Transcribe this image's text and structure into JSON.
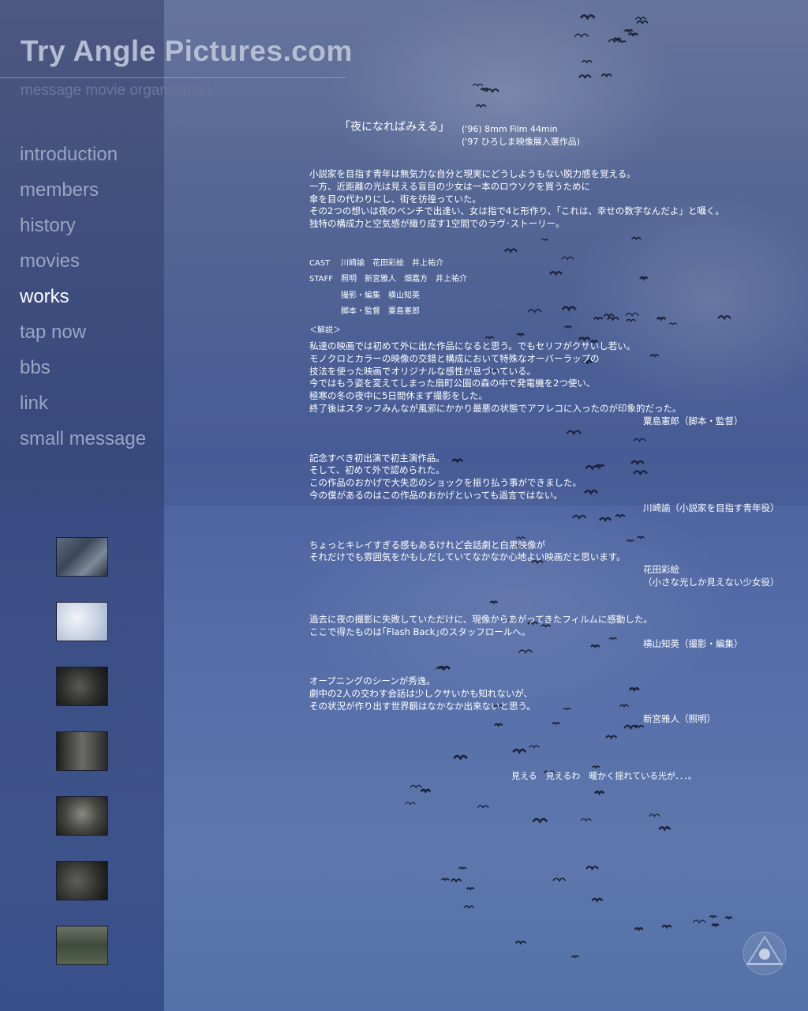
{
  "site": {
    "logo": "Try Angle Pictures.com",
    "tagline": "message movie organization"
  },
  "nav": {
    "items": [
      {
        "label": "introduction"
      },
      {
        "label": "members"
      },
      {
        "label": "history"
      },
      {
        "label": "movies"
      },
      {
        "label": "works",
        "active": true
      },
      {
        "label": "tap now"
      },
      {
        "label": "bbs"
      },
      {
        "label": "link"
      },
      {
        "label": "small message"
      }
    ]
  },
  "film": {
    "title": "「夜になればみえる」",
    "meta_line1": "('96) 8mm Film  44min",
    "meta_line2": "('97 ひろしま映像展入選作品)",
    "synopsis": [
      "小説家を目指す青年は無気力な自分と現実にどうしようもない脱力感を覚える。",
      "一方、近距離の光は見える盲目の少女は一本のロウソクを買うために",
      "傘を目の代わりにし、街を彷徨っていた。",
      "その2つの想いは夜のベンチで出逢い、女は指で4と形作り、「これは、幸せの数字なんだよ」と囁く。",
      "独特の構成力と空気感が織り成す1空間でのラヴ･ストーリー。"
    ],
    "credits": {
      "cast_label": "CAST",
      "cast": "川崎諭　花田彩絵　井上祐介",
      "staff_label": "STAFF",
      "staff1": "照明　新宮雅人　畑嘉方　井上祐介",
      "staff2": "撮影・編集　横山知英",
      "staff3": "脚本・監督　粟島憲郎"
    },
    "kaisetsu": "＜解説＞",
    "comments": [
      {
        "lines": [
          "私達の映画では初めて外に出た作品になると思う。でもセリフがクサいし若い。",
          "モノクロとカラーの映像の交錯と構成において特殊なオーバーラップの",
          "技法を使った映画でオリジナルな感性が息づいている。",
          "今ではもう姿を変えてしまった扇町公園の森の中で発電機を2つ使い、",
          "極寒の冬の夜中に5日間休まず撮影をした。",
          "終了後はスタッフみんなが風邪にかかり最悪の状態でアフレコに入ったのが印象的だった。"
        ],
        "sign": "粟島憲郎（脚本・監督）"
      },
      {
        "lines": [
          "記念すべき初出演で初主演作品。",
          "そして、初めて外で認められた。",
          "この作品のおかげで大失恋のショックを振り払う事ができました。",
          "今の僕があるのはこの作品のおかげといっても過言ではない。"
        ],
        "sign": "川崎諭（小説家を目指す青年役）"
      },
      {
        "lines": [
          "ちょっとキレイすぎる感もあるけれど会話劇と白黒映像が",
          "それだけでも雰囲気をかもしだしていてなかなか心地よい映画だと思います。"
        ],
        "sign": "花田彩絵",
        "sign2": "（小さな光しか見えない少女役）"
      },
      {
        "lines": [
          "過去に夜の撮影に失敗していただけに、現像からあがってきたフィルムに感動した。",
          "ここで得たものは｢Flash Back｣のスタッフロールへ。"
        ],
        "sign": "横山知英（撮影・編集）"
      },
      {
        "lines": [
          "オープニングのシーンが秀逸。",
          "劇中の2人の交わす会話は少しクサいかも知れないが、",
          "その状況が作り出す世界観はなかなか出来ないと思う。"
        ],
        "sign": "新宮雅人（照明）"
      }
    ],
    "closing": "見える　見えるわ　暖かく揺れている光が．．．。"
  },
  "icons": {
    "corner": "triangle-logo-icon"
  },
  "colors": {
    "sky": "#5a6d9e",
    "nav_inactive": "#9aa5c2",
    "nav_active": "#ffffff",
    "logo": "#b4bdd2"
  }
}
